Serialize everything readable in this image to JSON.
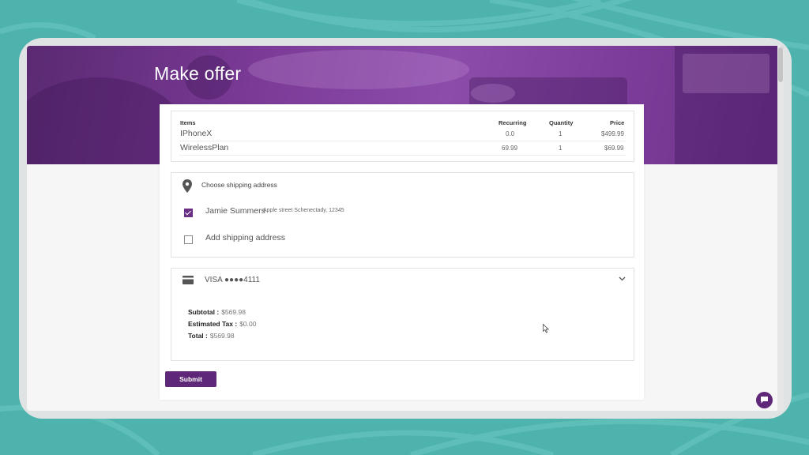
{
  "page": {
    "title": "Make offer"
  },
  "items_table": {
    "headers": {
      "items": "Items",
      "recurring": "Recurring",
      "quantity": "Quantity",
      "price": "Price"
    },
    "rows": [
      {
        "name": "IPhoneX",
        "recurring": "0.0",
        "quantity": "1",
        "price": "$499.99"
      },
      {
        "name": "WirelessPlan",
        "recurring": "69.99",
        "quantity": "1",
        "price": "$69.99"
      }
    ]
  },
  "shipping": {
    "heading": "Choose shipping address",
    "selected_name": "Jamie Summers",
    "selected_address": "Apple street Schenectady, 12345",
    "add_label": "Add shipping address"
  },
  "payment": {
    "card_label": "VISA ●●●●4111",
    "subtotal_label": "Subtotal :",
    "subtotal_value": "$569.98",
    "tax_label": "Estimated Tax :",
    "tax_value": "$0.00",
    "total_label": "Total :",
    "total_value": "$569.98"
  },
  "actions": {
    "submit_label": "Submit"
  },
  "icons": {
    "location": "map-pin-icon",
    "card": "credit-card-icon",
    "expand": "chevron-down-icon",
    "chat": "chat-icon"
  },
  "colors": {
    "accent": "#5f2777",
    "hero": "#7a3a96",
    "background": "#4fb3ad"
  }
}
